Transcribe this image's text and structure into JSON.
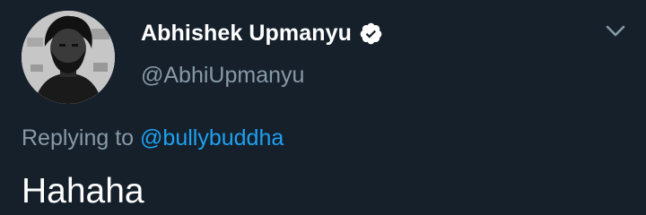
{
  "author": {
    "display_name": "Abhishek Upmanyu",
    "username": "@AbhiUpmanyu",
    "verified": true,
    "avatar_icon": "profile-photo"
  },
  "reply_context": {
    "prefix": "Replying to",
    "mention": "@bullybuddha"
  },
  "tweet": {
    "text": "Hahaha"
  },
  "icons": {
    "verified": "verified-badge-icon",
    "menu": "chevron-down-icon"
  },
  "colors": {
    "background": "#15202b",
    "primary_text": "#ffffff",
    "secondary_text": "#8899a6",
    "link": "#1da1f2"
  }
}
